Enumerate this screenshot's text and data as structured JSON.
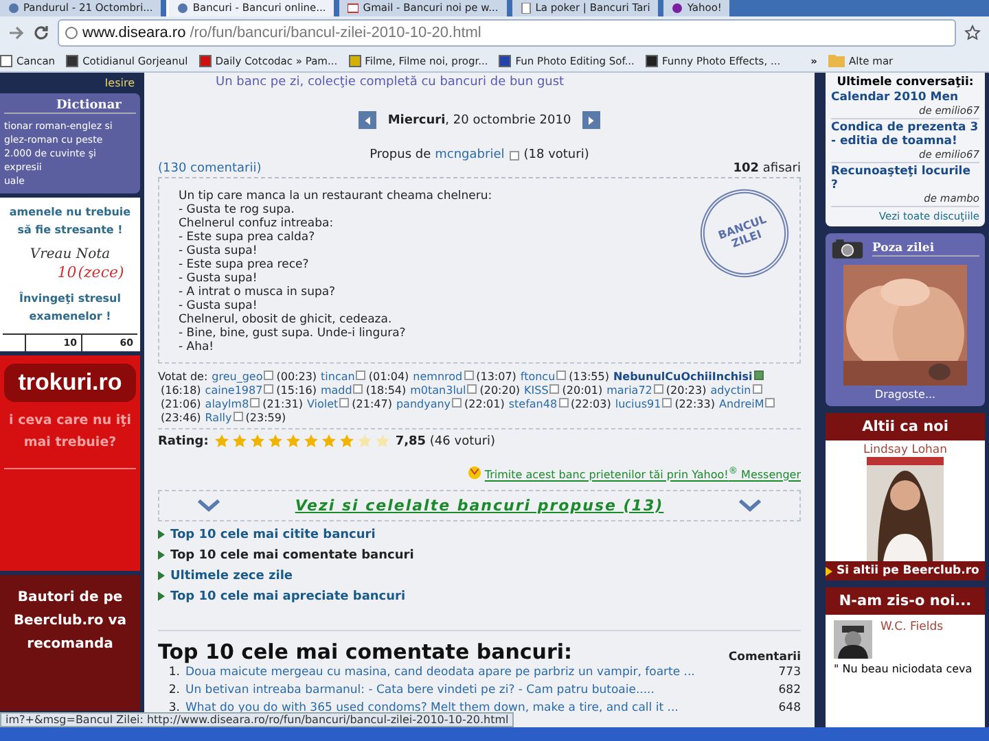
{
  "browser": {
    "tabs": [
      {
        "title": "Pandurul - 21 Octombri...",
        "selected": false,
        "kind": "page"
      },
      {
        "title": "Bancuri - Bancuri online...",
        "selected": true,
        "kind": "page"
      },
      {
        "title": "Gmail - Bancuri noi pe w...",
        "selected": false,
        "kind": "mail"
      },
      {
        "title": "La poker | Bancuri Tari",
        "selected": false,
        "kind": "doc"
      },
      {
        "title": "Yahoo!",
        "selected": false,
        "kind": "yahoo"
      }
    ],
    "url_host": "www.diseara.ro",
    "url_path": "/ro/fun/bancuri/bancul-zilei-2010-10-20.html",
    "bookmarks": [
      {
        "label": "Cancan",
        "color": "#ffffff"
      },
      {
        "label": "Cotidianul Gorjeanul",
        "color": "#333333"
      },
      {
        "label": "Daily Cotcodac » Pam...",
        "color": "#cc1111"
      },
      {
        "label": "Filme, Filme noi, progr...",
        "color": "#d4b000"
      },
      {
        "label": "Fun Photo Editing Sof...",
        "color": "#2244aa"
      },
      {
        "label": "Funny Photo Effects, ...",
        "color": "#222222"
      }
    ],
    "more": "»",
    "other_bookmarks": "Alte mar"
  },
  "left": {
    "logout": "Iesire",
    "dictionary_title": "Dictionar",
    "dictionary_text": "tionar roman-englez si\nglez-roman cu peste\n2.000 de cuvinte şi expresii\nuale",
    "exam_ad": {
      "line1": "amenele nu trebuie\nsă fie stresante !",
      "script": "Vreau Nota",
      "score": "10",
      "score_word": "(zece)",
      "line2": "Învingeţi stresul\nexamenelor !",
      "cells": [
        "10",
        "60"
      ]
    },
    "trokuri": {
      "logo": "trokuri.ro",
      "text": "i ceva care nu iţi\nmai trebuie?"
    },
    "beerclub": "Bautori de pe\nBeerclub.ro va\nrecomanda"
  },
  "center": {
    "tagline": "Un banc pe zi, colecţie completă cu bancuri de bun gust",
    "day": "Miercuri",
    "date": ", 20 octombrie 2010",
    "proposed_by": "Propus de",
    "author": "mcngabriel",
    "author_votes": "(18 voturi)",
    "comments": "(130 comentarii)",
    "views_count": "102",
    "views_label": "afisari",
    "stamp": [
      "BANCUL",
      "ZILEI"
    ],
    "joke": "Un tip care manca la un restaurant cheama chelneru:\n- Gusta te rog supa.\nChelnerul confuz intreaba:\n- Este supa prea calda?\n- Gusta supa!\n- Este supa prea rece?\n- Gusta supa!\n- A intrat o musca in supa?\n- Gusta supa!\nChelnerul, obosit de ghicit, cedeaza.\n- Bine, bine, gust supa. Unde-i lingura?\n- Aha!",
    "voted_label": "Votat de:",
    "voters": [
      {
        "name": "greu_geo",
        "time": "(00:23)",
        "highlighted": false
      },
      {
        "name": "tincan",
        "time": "(01:04)",
        "highlighted": false
      },
      {
        "name": "nemnrod",
        "time": "(13:07)",
        "highlighted": false
      },
      {
        "name": "ftoncu",
        "time": "(13:55)",
        "highlighted": false
      },
      {
        "name": "NebunulCuOchiiInchisi",
        "time": "(16:18)",
        "highlighted": true
      },
      {
        "name": "caine1987",
        "time": "(15:16)",
        "highlighted": false
      },
      {
        "name": "madd",
        "time": "(18:54)",
        "highlighted": false
      },
      {
        "name": "m0tan3lul",
        "time": "(20:20)",
        "highlighted": false
      },
      {
        "name": "KISS",
        "time": "(20:01)",
        "highlighted": false
      },
      {
        "name": "maria72",
        "time": "(20:23)",
        "highlighted": false
      },
      {
        "name": "adyctin",
        "time": "(21:06)",
        "highlighted": false
      },
      {
        "name": "alaylm8",
        "time": "(21:31)",
        "highlighted": false
      },
      {
        "name": "Violet",
        "time": "(21:47)",
        "highlighted": false
      },
      {
        "name": "pandyany",
        "time": "(22:01)",
        "highlighted": false
      },
      {
        "name": "stefan48",
        "time": "(22:03)",
        "highlighted": false
      },
      {
        "name": "lucius91",
        "time": "(22:33)",
        "highlighted": false
      },
      {
        "name": "AndreiM",
        "time": "(23:46)",
        "highlighted": false
      },
      {
        "name": "Rally",
        "time": "(23:59)",
        "highlighted": false
      }
    ],
    "rating_label": "Rating:",
    "rating": {
      "stars": 8
    },
    "rating_value": "7,85",
    "rating_votes": "(46 voturi)",
    "yahoo_link": "Trimite acest banc prietenilor tăi prin Yahoo!$^{®}$ Messenger",
    "more_jokes": "Vezi si celelalte bancuri propuse (13)",
    "links": [
      {
        "label": "Top 10 cele mai citite bancuri",
        "selected": false
      },
      {
        "label": "Top 10 cele mai comentate bancuri",
        "selected": true
      },
      {
        "label": "Ultimele zece zile",
        "selected": false
      },
      {
        "label": "Top 10 cele mai apreciate bancuri",
        "selected": false
      }
    ],
    "top_title": "Top 10 cele mai comentate bancuri:",
    "top_column": "Comentarii",
    "top_rows": [
      {
        "rank": "1.",
        "title": "Doua maicute mergeau cu masina, cand deodata apare pe parbriz un vampir, foarte ...",
        "count": "773"
      },
      {
        "rank": "2.",
        "title": "Un betivan intreaba barmanul: - Cata bere vindeti pe zi? - Cam patru butoaie.....",
        "count": "682"
      },
      {
        "rank": "3.",
        "title": "What do you do with 365 used condoms? Melt them down, make a tire, and call it ...",
        "count": "648"
      }
    ]
  },
  "right": {
    "conv_title": "Ultimele conversaţii:",
    "conversations": [
      {
        "title": "Calendar 2010 Men",
        "by": "de emilio67"
      },
      {
        "title": "Condica de prezenta 3 - editia de toamna!",
        "by": "de emilio67"
      },
      {
        "title": "Recunoaşteţi locurile ?",
        "by": "de mambo"
      }
    ],
    "all_conv": "Vezi toate discuţiile",
    "photo_title": "Poza zilei",
    "photo_caption": "Dragoste...",
    "others_title": "Altii ca noi",
    "others_name": "Lindsay Lohan",
    "others_link": "Si altii pe Beerclub.ro",
    "quote_title": "N-am zis-o noi...",
    "quote_author": "W.C. Fields",
    "quote_text": "\" Nu beau niciodata ceva"
  },
  "status_bar": "im?+&msg=Bancul Zilei: http://www.diseara.ro/ro/fun/bancuri/bancul-zilei-2010-10-20.html"
}
